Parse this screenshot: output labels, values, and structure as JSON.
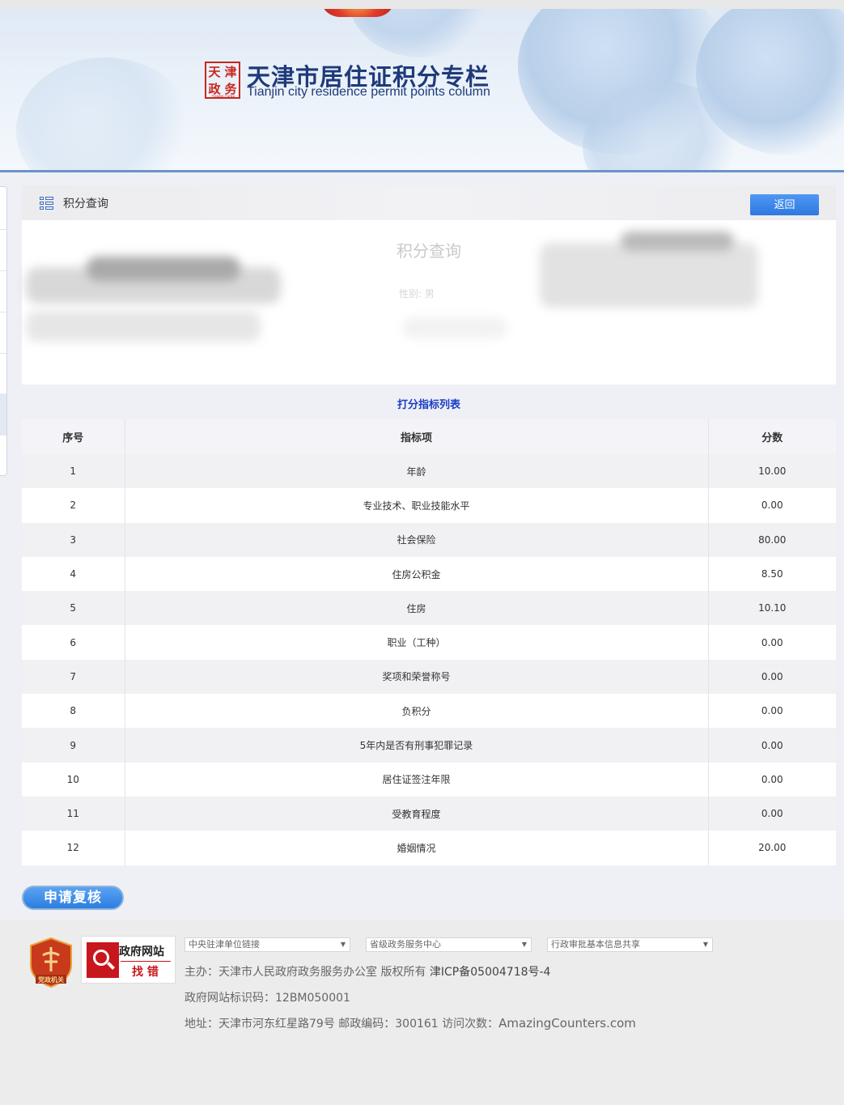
{
  "site": {
    "seal_chars": [
      "天",
      "津",
      "政",
      "务"
    ],
    "seal_sub": "TIANJIN CHINA",
    "title": "天津市居住证积分专栏",
    "subtitle": "Tianjin city residence permit points column"
  },
  "panel": {
    "title": "积分查询",
    "back_label": "返回"
  },
  "info": {
    "title": "积分查询",
    "gender": "性别: 男"
  },
  "table": {
    "caption": "打分指标列表",
    "headers": [
      "序号",
      "指标项",
      "分数"
    ],
    "rows": [
      {
        "idx": "1",
        "item": "年龄",
        "score": "10.00"
      },
      {
        "idx": "2",
        "item": "专业技术、职业技能水平",
        "score": "0.00"
      },
      {
        "idx": "3",
        "item": "社会保险",
        "score": "80.00"
      },
      {
        "idx": "4",
        "item": "住房公积金",
        "score": "8.50"
      },
      {
        "idx": "5",
        "item": "住房",
        "score": "10.10"
      },
      {
        "idx": "6",
        "item": "职业（工种）",
        "score": "0.00"
      },
      {
        "idx": "7",
        "item": "奖项和荣誉称号",
        "score": "0.00"
      },
      {
        "idx": "8",
        "item": "负积分",
        "score": "0.00"
      },
      {
        "idx": "9",
        "item": "5年内是否有刑事犯罪记录",
        "score": "0.00"
      },
      {
        "idx": "10",
        "item": "居住证签注年限",
        "score": "0.00"
      },
      {
        "idx": "11",
        "item": "受教育程度",
        "score": "0.00"
      },
      {
        "idx": "12",
        "item": "婚姻情况",
        "score": "20.00"
      }
    ]
  },
  "review_label": "申请复核",
  "footer": {
    "badge_text": "党政机关",
    "zfwz_top": "政府网站",
    "zfwz_bottom": "找 错",
    "selects": [
      "中央驻津单位链接",
      "省级政务服务中心",
      "行政审批基本信息共享"
    ],
    "sponsor": "主办：天津市人民政府政务服务办公室 版权所有 ",
    "icp": "津ICP备05004718号-4",
    "site_id": "政府网站标识码：12BM050001",
    "address": "地址：天津市河东红星路79号 邮政编码：300161 访问次数：",
    "counter_alt": "AmazingCounters.com"
  },
  "colors": {
    "accent_blue": "#2f78df",
    "title_navy": "#1f3a7a",
    "seal_red": "#c8271f",
    "caption_blue": "#1a3cc2"
  }
}
